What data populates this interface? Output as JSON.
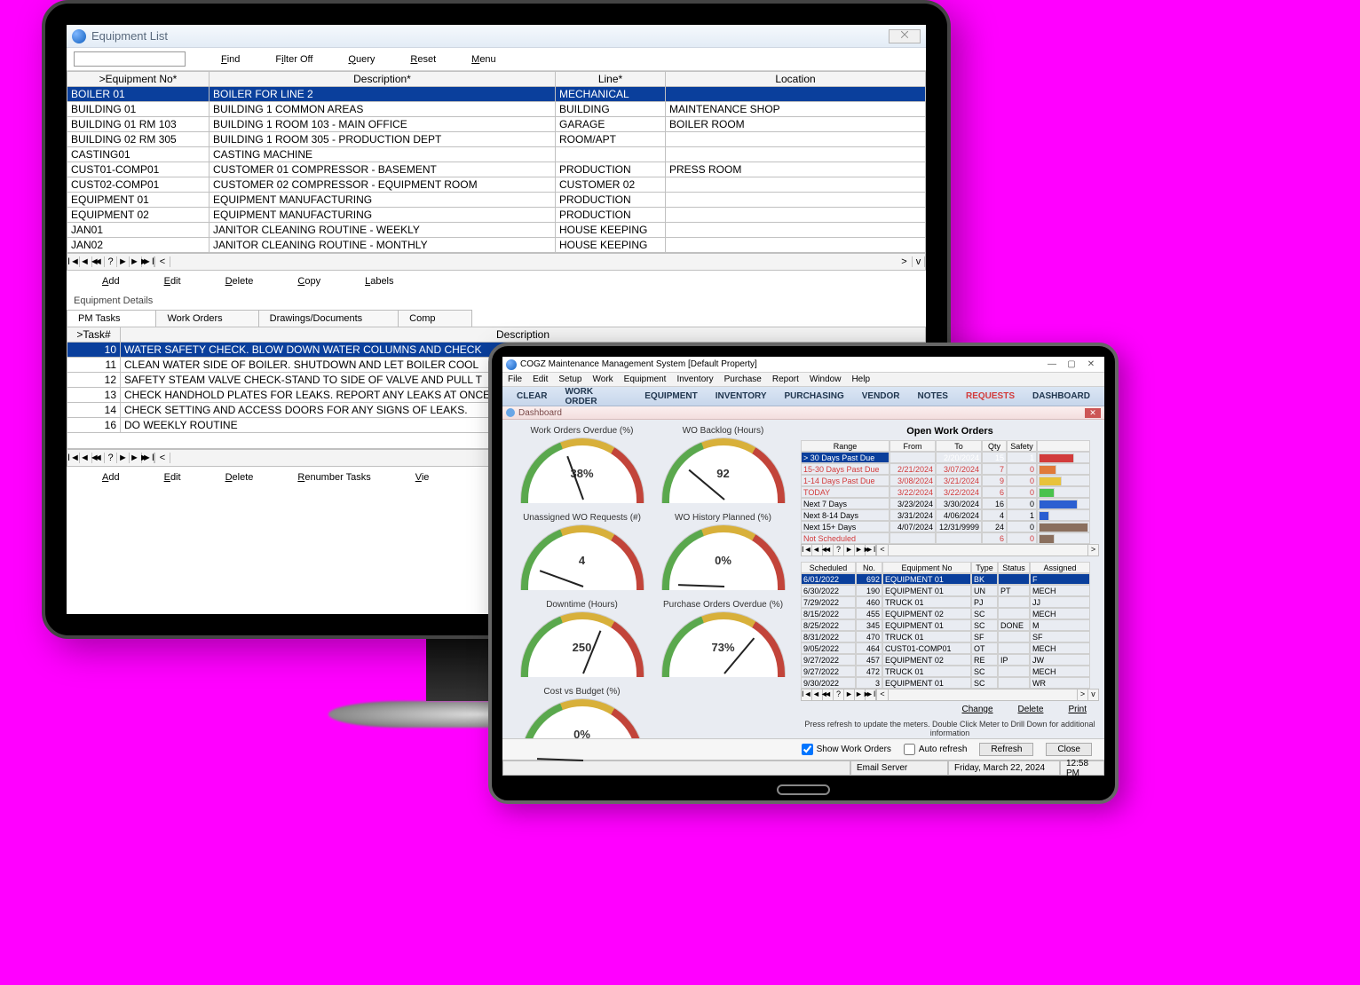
{
  "eq_window": {
    "title": "Equipment List",
    "close_glyph": "⨉",
    "menu": {
      "find": "Find",
      "filter": "Filter Off",
      "query": "Query",
      "reset": "Reset",
      "menu": "Menu"
    }
  },
  "eq_headers": {
    "eqno": ">Equipment No*",
    "desc": "Description*",
    "line": "Line*",
    "loc": "Location"
  },
  "eq_rows": [
    {
      "eqno": "BOILER 01",
      "desc": "BOILER FOR LINE 2",
      "line": "MECHANICAL",
      "loc": ""
    },
    {
      "eqno": "BUILDING 01",
      "desc": "BUILDING 1 COMMON AREAS",
      "line": "BUILDING",
      "loc": "MAINTENANCE SHOP"
    },
    {
      "eqno": "BUILDING 01 RM 103",
      "desc": "BUILDING 1 ROOM 103 - MAIN OFFICE",
      "line": "GARAGE",
      "loc": "BOILER ROOM"
    },
    {
      "eqno": "BUILDING 02 RM 305",
      "desc": "BUILDING 1 ROOM 305 - PRODUCTION DEPT",
      "line": "ROOM/APT",
      "loc": ""
    },
    {
      "eqno": "CASTING01",
      "desc": "CASTING MACHINE",
      "line": "",
      "loc": ""
    },
    {
      "eqno": "CUST01-COMP01",
      "desc": "CUSTOMER 01 COMPRESSOR - BASEMENT",
      "line": "PRODUCTION",
      "loc": "PRESS ROOM"
    },
    {
      "eqno": "CUST02-COMP01",
      "desc": "CUSTOMER 02 COMPRESSOR - EQUIPMENT ROOM",
      "line": "CUSTOMER 02",
      "loc": ""
    },
    {
      "eqno": "EQUIPMENT 01",
      "desc": "EQUIPMENT MANUFACTURING",
      "line": "PRODUCTION",
      "loc": ""
    },
    {
      "eqno": "EQUIPMENT 02",
      "desc": "EQUIPMENT MANUFACTURING",
      "line": "PRODUCTION",
      "loc": ""
    },
    {
      "eqno": "JAN01",
      "desc": "JANITOR CLEANING ROUTINE - WEEKLY",
      "line": "HOUSE KEEPING",
      "loc": ""
    },
    {
      "eqno": "JAN02",
      "desc": "JANITOR CLEANING ROUTINE - MONTHLY",
      "line": "HOUSE KEEPING",
      "loc": ""
    }
  ],
  "eq_btns": {
    "add": "Add",
    "edit": "Edit",
    "delete": "Delete",
    "copy": "Copy",
    "labels": "Labels"
  },
  "eq_details": {
    "legend": "Equipment Details",
    "tabs": {
      "pm": "PM Tasks",
      "wo": "Work Orders",
      "dd": "Drawings/Documents",
      "comp": "Comp"
    },
    "headers": {
      "task": ">Task#",
      "desc": "Description"
    },
    "rows": [
      {
        "n": "10",
        "d": "WATER SAFETY CHECK. BLOW DOWN WATER COLUMNS AND CHECK"
      },
      {
        "n": "11",
        "d": "CLEAN WATER SIDE OF BOILER.  SHUTDOWN AND LET BOILER COOL"
      },
      {
        "n": "12",
        "d": "SAFETY STEAM VALVE CHECK-STAND TO SIDE OF VALVE AND PULL T"
      },
      {
        "n": "13",
        "d": "CHECK HANDHOLD PLATES FOR LEAKS. REPORT ANY LEAKS AT ONCE"
      },
      {
        "n": "14",
        "d": "CHECK SETTING AND ACCESS DOORS FOR ANY SIGNS OF LEAKS."
      },
      {
        "n": "16",
        "d": "DO WEEKLY ROUTINE"
      }
    ],
    "btns": {
      "add": "Add",
      "edit": "Edit",
      "delete": "Delete",
      "renumber": "Renumber Tasks",
      "view": "Vie"
    }
  },
  "dash": {
    "app_title": "COGZ Maintenance Management System [Default Property]",
    "sub_title": "Dashboard",
    "menubar": [
      "File",
      "Edit",
      "Setup",
      "Work",
      "Equipment",
      "Inventory",
      "Purchase",
      "Report",
      "Window",
      "Help"
    ],
    "ribbon": [
      "CLEAR",
      "WORK ORDER",
      "EQUIPMENT",
      "INVENTORY",
      "PURCHASING",
      "VENDOR",
      "NOTES",
      "REQUESTS",
      "DASHBOARD"
    ],
    "gauges": [
      {
        "title": "Work Orders Overdue (%)",
        "value": "38%",
        "ticks": "0 10 20 30 40 50 60 70 80 90 100",
        "angle": -20
      },
      {
        "title": "WO Backlog (Hours)",
        "value": "92",
        "ticks": "0 40 80 120 160 200 240 280 320 360 400",
        "angle": -50
      },
      {
        "title": "Unassigned WO Requests (#)",
        "value": "4",
        "ticks": "0 4 8 12 16 20 24 28 32 36 40",
        "angle": -70
      },
      {
        "title": "WO History Planned (%)",
        "value": "0%",
        "ticks": "0 10 20 30 40 50 60 70 80 90 100",
        "angle": -88
      },
      {
        "title": "Downtime (Hours)",
        "value": "250",
        "ticks": "0 40 80 120 160 200 240 280 320 360 400",
        "angle": 22
      },
      {
        "title": "Purchase Orders Overdue (%)",
        "value": "73%",
        "ticks": "0 10 20 30 40 50 60 70 80 90 100",
        "angle": 40
      },
      {
        "title": "Cost vs Budget (%)",
        "value": "0%",
        "ticks": "0 20 40 60 80 100 120 140 160 180 200",
        "angle": -88
      }
    ],
    "owo_title": "Open Work Orders",
    "range_headers": {
      "r": "Range",
      "f": "From",
      "t": "To",
      "q": "Qty",
      "s": "Safety"
    },
    "ranges": [
      {
        "r": "> 30 Days Past Due",
        "f": "",
        "t": "2/20/2024",
        "q": "15",
        "s": "1",
        "c": "#d23b3b",
        "bw": 40,
        "fg": "#fff",
        "bg": "#0a3f9c"
      },
      {
        "r": "15-30 Days Past Due",
        "f": "2/21/2024",
        "t": "3/07/2024",
        "q": "7",
        "s": "0",
        "c": "#e07a3a",
        "bw": 20,
        "fg": "#d23b3b"
      },
      {
        "r": "1-14 Days Past Due",
        "f": "3/08/2024",
        "t": "3/21/2024",
        "q": "9",
        "s": "0",
        "c": "#e8c23a",
        "bw": 26,
        "fg": "#d23b3b"
      },
      {
        "r": "TODAY",
        "f": "3/22/2024",
        "t": "3/22/2024",
        "q": "6",
        "s": "0",
        "c": "#49c24d",
        "bw": 18,
        "fg": "#d23b3b"
      },
      {
        "r": "Next 7 Days",
        "f": "3/23/2024",
        "t": "3/30/2024",
        "q": "16",
        "s": "0",
        "c": "#2b5fd1",
        "bw": 44
      },
      {
        "r": "Next 8-14 Days",
        "f": "3/31/2024",
        "t": "4/06/2024",
        "q": "4",
        "s": "1",
        "c": "#2b5fd1",
        "bw": 12
      },
      {
        "r": "Next 15+ Days",
        "f": "4/07/2024",
        "t": "12/31/9999",
        "q": "24",
        "s": "0",
        "c": "#8a6f5e",
        "bw": 56
      },
      {
        "r": "Not Scheduled",
        "f": "",
        "t": "",
        "q": "6",
        "s": "0",
        "c": "#8a6f5e",
        "bw": 18,
        "fg": "#d23b3b"
      }
    ],
    "sched_headers": {
      "sch": "Scheduled",
      "no": "No.",
      "eq": "Equipment No",
      "type": "Type",
      "st": "Status",
      "as": "Assigned"
    },
    "sched": [
      {
        "d": "6/01/2022",
        "n": "692",
        "e": "EQUIPMENT 01",
        "t": "BK",
        "s": "",
        "a": "F",
        "sel": true
      },
      {
        "d": "6/30/2022",
        "n": "190",
        "e": "EQUIPMENT 01",
        "t": "UN",
        "s": "PT",
        "a": "MECH"
      },
      {
        "d": "7/29/2022",
        "n": "460",
        "e": "TRUCK 01",
        "t": "PJ",
        "s": "",
        "a": "JJ"
      },
      {
        "d": "8/15/2022",
        "n": "455",
        "e": "EQUIPMENT 02",
        "t": "SC",
        "s": "",
        "a": "MECH"
      },
      {
        "d": "8/25/2022",
        "n": "345",
        "e": "EQUIPMENT 01",
        "t": "SC",
        "s": "DONE",
        "a": "M"
      },
      {
        "d": "8/31/2022",
        "n": "470",
        "e": "TRUCK 01",
        "t": "SF",
        "s": "",
        "a": "SF"
      },
      {
        "d": "9/05/2022",
        "n": "464",
        "e": "CUST01-COMP01",
        "t": "OT",
        "s": "",
        "a": "MECH"
      },
      {
        "d": "9/27/2022",
        "n": "457",
        "e": "EQUIPMENT 02",
        "t": "RE",
        "s": "IP",
        "a": "JW"
      },
      {
        "d": "9/27/2022",
        "n": "472",
        "e": "TRUCK 01",
        "t": "SC",
        "s": "",
        "a": "MECH"
      },
      {
        "d": "9/30/2022",
        "n": "3",
        "e": "EQUIPMENT 01",
        "t": "SC",
        "s": "",
        "a": "WR"
      }
    ],
    "links": {
      "change": "Change",
      "delete": "Delete",
      "print": "Print"
    },
    "hint": "Press refresh to update the meters.   Double Click Meter to Drill Down for additional information",
    "footer": {
      "show": "Show Work Orders",
      "auto": "Auto refresh",
      "refresh": "Refresh",
      "close": "Close"
    },
    "status": {
      "email": "Email Server",
      "date": "Friday, March 22, 2024",
      "time": "12:58 PM"
    }
  }
}
